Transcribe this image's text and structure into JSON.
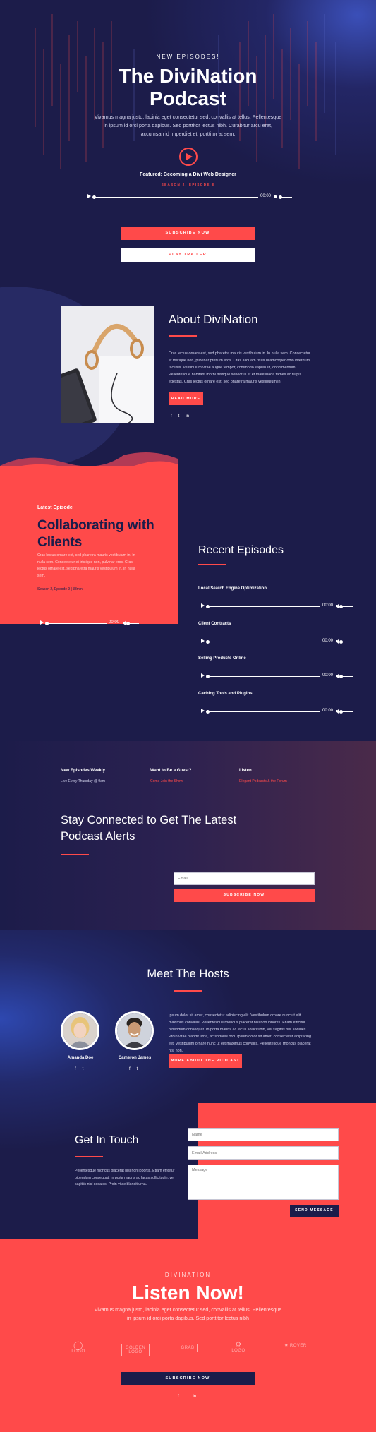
{
  "colors": {
    "navy": "#1c1c4a",
    "red": "#ff4a4a",
    "white": "#ffffff"
  },
  "hero": {
    "eyebrow": "NEW EPISODES!",
    "title_line1": "The DiviNation",
    "title_line2": "Podcast",
    "description": "Vivamus magna justo, lacinia eget consectetur sed, convallis at tellus. Pellentesque in ipsum id orci porta dapibus. Sed porttitor lectus nibh. Curabitur arcu erat, accumsan id imperdiet et, porttitor at sem.",
    "featured": "Featured: Becoming a Divi Web Designer",
    "season": "SEASON 2, EPISODE 8",
    "time": "00:00",
    "subscribe": "SUBSCRIBE NOW",
    "trailer": "PLAY TRAILER"
  },
  "about": {
    "title": "About DiviNation",
    "text": "Cras lectus ornare est, sed pharetra mauris vestibulum in. In nulla sem. Consectetur et tristique non, pulvinar pretium eros. Cras aliquam risus ullamcorper odio interdum facilisis. Vestibulum vitae augue tempor, commodo sapien ut, condimentum. Pellentesque habitant morbi tristique senectus et et malesuada fames ac turpis egestas. Cras lectus ornare est, sed pharetra mauris vestibulum in.",
    "button": "READ MORE",
    "social": [
      "f",
      "t",
      "in"
    ]
  },
  "latest": {
    "label": "Latest Episode",
    "title": "Collaborating with Clients",
    "text": "Cras lectus ornare est, sed pharetra mauris vestibulum in. In nulla sem. Consectetur et tristique non, pulvinar eros. Cras lectus ornare est, sed pharetra mauris vestibulum in. In nulla sem.",
    "meta": "Season 2, Episode 9   |   38min",
    "time": "00:00"
  },
  "recent": {
    "title": "Recent Episodes",
    "episodes": [
      {
        "name": "Local Search Engine Optimization",
        "time": "00:00"
      },
      {
        "name": "Client Contracts",
        "time": "00:00"
      },
      {
        "name": "Selling Products Online",
        "time": "00:00"
      },
      {
        "name": "Caching Tools and Plugins",
        "time": "00:00"
      }
    ]
  },
  "connect": {
    "info": [
      {
        "head": "New Episodes Weekly",
        "sub": "Live Every Thursday @ 9am"
      },
      {
        "head": "Want to Be a Guest?",
        "sub": "Come Join the Show"
      },
      {
        "head": "Listen",
        "sub": "Elegant Podcasts & the Forum"
      }
    ],
    "title": "Stay Connected to Get The Latest Podcast Alerts",
    "email_placeholder": "Email",
    "button": "SUBSCRIBE NOW"
  },
  "hosts": {
    "title": "Meet The Hosts",
    "people": [
      {
        "name": "Amanda Doe"
      },
      {
        "name": "Cameron James"
      }
    ],
    "text": "Ipsum dolor sit amet, consectetur adipiscing elit. Vestibulum ornare nunc ut elit maximus convallis. Pellentesque rhoncus placerat nisi non lobortis. Etiam efficitur bibendum consequat. In porta mauris ac lacus sollicitudin, vel sagittis nisl sodales. Proin vitae blandit urna, ac sodales orci. Ipsum dolor sit amet, consectetur adipiscing elit. Vestibulum ornare nunc ut elit maximus convallis. Pellentesque rhoncus placerat nisi non.",
    "button": "MORE ABOUT THE PODCAST"
  },
  "contact": {
    "title": "Get In Touch",
    "text": "Pellentesque rhoncus placerat nisi non lobortis. Etiam efficitur bibendum consequat. In porta mauris ac lacus sollicitudin, vel sagittis nisl sodales. Proin vitae blandit urna.",
    "name_placeholder": "Name",
    "email_placeholder": "Email Address",
    "message_placeholder": "Message",
    "button": "SEND MESSAGE"
  },
  "listen": {
    "eyebrow": "DIVINATION",
    "title": "Listen Now!",
    "description": "Vivamus magna justo, lacinia eget consectetur sed, convallis at tellus. Pellentesque in ipsum id orci porta dapibus. Sed porttitor lectus nibh",
    "logos": [
      "LOGO",
      "GOLDEN LOGO",
      "GRAB",
      "LOGO",
      "ROVER"
    ],
    "button": "SUBSCRIBE NOW",
    "social": [
      "f",
      "t",
      "in"
    ]
  }
}
